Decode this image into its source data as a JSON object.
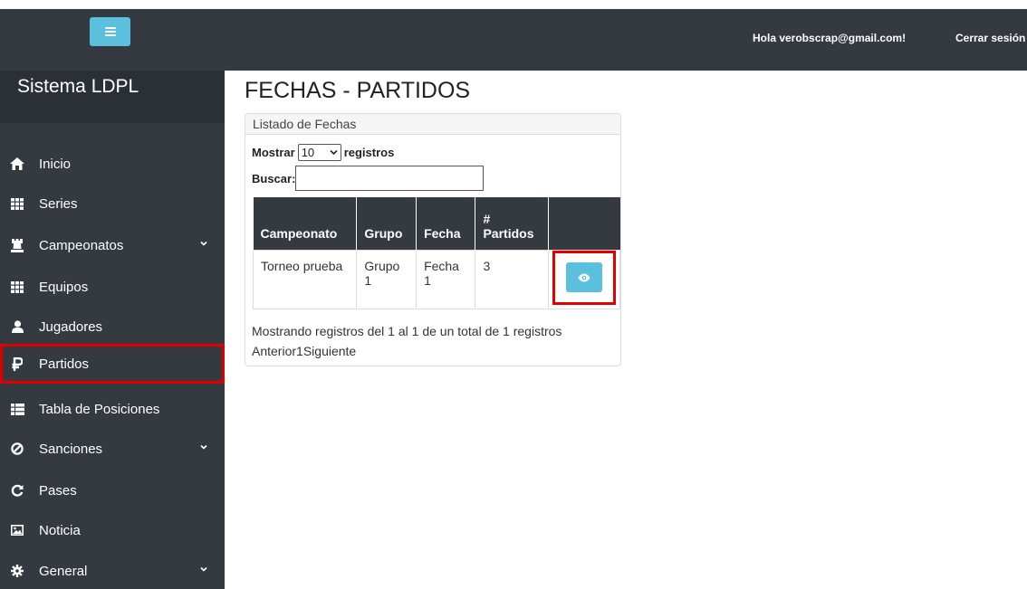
{
  "topbar": {
    "greeting": "Hola verobscrap@gmail.com!",
    "logout_label": "Cerrar sesión"
  },
  "sidebar": {
    "brand": "Sistema LDPL",
    "items": [
      {
        "label": "Inicio",
        "icon": "home-icon"
      },
      {
        "label": "Series",
        "icon": "grid-icon"
      },
      {
        "label": "Campeonatos",
        "icon": "chess-rook-icon",
        "expandable": true
      },
      {
        "label": "Equipos",
        "icon": "grid-icon"
      },
      {
        "label": "Jugadores",
        "icon": "user-icon"
      },
      {
        "label": "Partidos",
        "icon": "ruble-icon",
        "active": true
      },
      {
        "label": "Tabla de Posiciones",
        "icon": "list-icon"
      },
      {
        "label": "Sanciones",
        "icon": "ban-icon",
        "expandable": true
      },
      {
        "label": "Pases",
        "icon": "refresh-icon"
      },
      {
        "label": "Noticia",
        "icon": "image-icon"
      },
      {
        "label": "General",
        "icon": "gear-icon",
        "expandable": true
      }
    ]
  },
  "main": {
    "title": "FECHAS - PARTIDOS",
    "card_title": "Listado de Fechas",
    "show_prefix": "Mostrar",
    "show_value": "10",
    "show_suffix": "registros",
    "search_label": "Buscar:",
    "search_value": "",
    "columns": [
      "Campeonato",
      "Grupo",
      "Fecha",
      "#",
      "Partidos"
    ],
    "rows": [
      {
        "campeonato": "Torneo prueba",
        "grupo": "Grupo 1",
        "fecha": "Fecha 1",
        "partidos": "3"
      }
    ],
    "info": "Mostrando registros del 1 al 1 de un total de 1 registros",
    "pager": {
      "prev": "Anterior",
      "page": "1",
      "next": "Siguiente"
    }
  },
  "colors": {
    "sidebar_bg": "#343a40",
    "accent": "#5bc0de",
    "highlight": "#e00000"
  }
}
